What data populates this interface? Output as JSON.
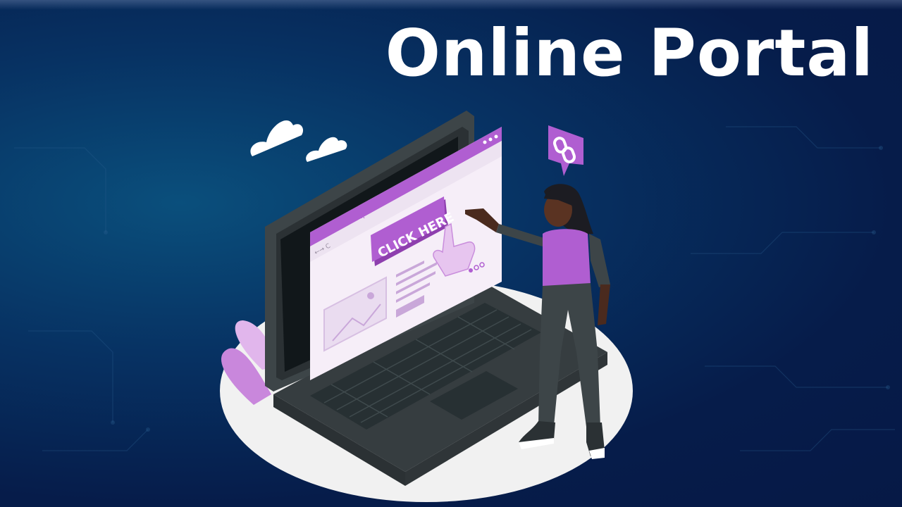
{
  "page": {
    "title": "Online Portal",
    "colors": {
      "background_dark": "#061946",
      "background_light": "#0a4f7c",
      "accent_purple": "#b05ed1",
      "laptop_dark": "#3d4548",
      "platform": "#f2f2f2",
      "screen_light": "#f6eef8"
    }
  },
  "browser": {
    "button_label": "CLICK HERE",
    "close_glyph": "x",
    "nav_glyphs": "←→ C"
  },
  "icons": {
    "link_badge": "link-icon",
    "cursor": "pointer-hand-icon",
    "clouds": "cloud-icon",
    "image_placeholder": "image-icon"
  }
}
